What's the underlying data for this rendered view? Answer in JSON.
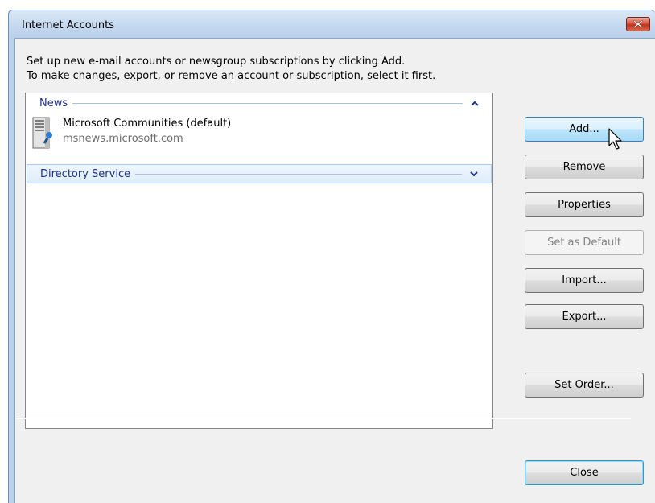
{
  "window": {
    "title": "Internet Accounts"
  },
  "description": {
    "line1": "Set up new e-mail accounts or newsgroup subscriptions by clicking Add.",
    "line2": "To make changes, export, or remove an account or subscription, select it first."
  },
  "groups": [
    {
      "label": "News",
      "expanded": true
    },
    {
      "label": "Directory Service",
      "expanded": false
    }
  ],
  "account": {
    "name": "Microsoft Communities (default)",
    "server": "msnews.microsoft.com",
    "icon": "news-server-icon"
  },
  "buttons": {
    "add": "Add...",
    "remove": "Remove",
    "properties": "Properties",
    "set_default": "Set as Default",
    "import": "Import...",
    "export": "Export...",
    "set_order": "Set Order...",
    "close": "Close"
  },
  "colors": {
    "group_header_text": "#1e3287",
    "close_button_red": "#c1331b"
  }
}
